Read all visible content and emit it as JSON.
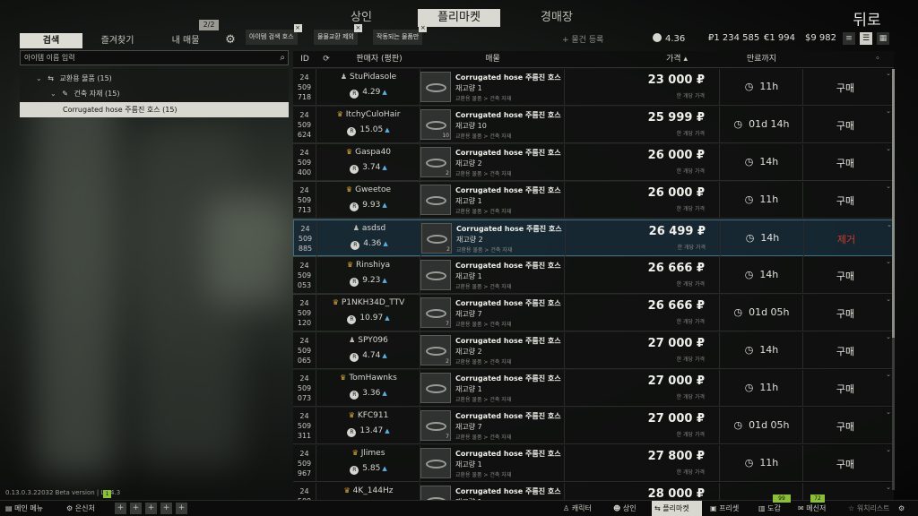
{
  "top_tabs": {
    "traders": "상인",
    "flea_market": "플리마켓",
    "auction": "경매장"
  },
  "back_label": "뒤로",
  "left_tabs": {
    "search": "검색",
    "favorites": "즐겨찾기",
    "my_offers": "내 매물",
    "my_offers_count": "2/2"
  },
  "filter_chips": [
    "아이템 검색 호스",
    "물물교환 제외",
    "작동되는 물품만"
  ],
  "search": {
    "placeholder": "아이템 이름 입력"
  },
  "tree": {
    "level1": "교환용 물품 (15)",
    "level2": "건축 자재 (15)",
    "level3": "Corrugated hose 주름진 호스 (15)"
  },
  "add_offer_label": "+ 물건 등록",
  "currencies": {
    "rep": "4.36",
    "roubles": "₽1 234 585",
    "euros": "€1 994",
    "dollars": "$9 982"
  },
  "table_headers": {
    "id": "ID",
    "seller": "판매자 (평판)",
    "item": "매물",
    "price": "가격",
    "expires": "만료까지"
  },
  "item_name": "Corrugated hose 주름진 호스",
  "item_category": "교환용 물품 > 건축 자재",
  "unit_price_label": "한 개당 가격",
  "rows": [
    {
      "id": [
        "24",
        "509",
        "718"
      ],
      "seller": "StuPidasole",
      "seller_type": "player",
      "rep": "4.29",
      "stock": "재고량 1",
      "count": "",
      "price": "23 000 ₽",
      "expires": "11h",
      "action": "구매",
      "mine": false
    },
    {
      "id": [
        "24",
        "509",
        "624"
      ],
      "seller": "ItchyCuloHair",
      "seller_type": "crown",
      "rep": "15.05",
      "stock": "재고량 10",
      "count": "10",
      "price": "25 999 ₽",
      "expires": "01d 14h",
      "action": "구매",
      "mine": false
    },
    {
      "id": [
        "24",
        "509",
        "400"
      ],
      "seller": "Gaspa40",
      "seller_type": "crown",
      "rep": "3.74",
      "stock": "재고량 2",
      "count": "2",
      "price": "26 000 ₽",
      "expires": "14h",
      "action": "구매",
      "mine": false
    },
    {
      "id": [
        "24",
        "509",
        "713"
      ],
      "seller": "Gweetoe",
      "seller_type": "crown",
      "rep": "9.93",
      "stock": "재고량 1",
      "count": "",
      "price": "26 000 ₽",
      "expires": "11h",
      "action": "구매",
      "mine": false
    },
    {
      "id": [
        "24",
        "509",
        "885"
      ],
      "seller": "asdsd",
      "seller_type": "player",
      "rep": "4.36",
      "stock": "재고량 2",
      "count": "2",
      "price": "26 499 ₽",
      "expires": "14h",
      "action": "제거",
      "mine": true
    },
    {
      "id": [
        "24",
        "509",
        "053"
      ],
      "seller": "Rinshiya",
      "seller_type": "crown",
      "rep": "9.23",
      "stock": "재고량 1",
      "count": "",
      "price": "26 666 ₽",
      "expires": "14h",
      "action": "구매",
      "mine": false
    },
    {
      "id": [
        "24",
        "509",
        "120"
      ],
      "seller": "P1NKH34D_TTV",
      "seller_type": "crown",
      "rep": "10.97",
      "stock": "재고량 7",
      "count": "7",
      "price": "26 666 ₽",
      "expires": "01d 05h",
      "action": "구매",
      "mine": false
    },
    {
      "id": [
        "24",
        "509",
        "065"
      ],
      "seller": "SPY096",
      "seller_type": "player",
      "rep": "4.74",
      "stock": "재고량 2",
      "count": "2",
      "price": "27 000 ₽",
      "expires": "14h",
      "action": "구매",
      "mine": false
    },
    {
      "id": [
        "24",
        "509",
        "073"
      ],
      "seller": "TomHawnks",
      "seller_type": "crown",
      "rep": "3.36",
      "stock": "재고량 1",
      "count": "",
      "price": "27 000 ₽",
      "expires": "11h",
      "action": "구매",
      "mine": false
    },
    {
      "id": [
        "24",
        "509",
        "311"
      ],
      "seller": "KFC911",
      "seller_type": "crown",
      "rep": "13.47",
      "stock": "재고량 7",
      "count": "7",
      "price": "27 000 ₽",
      "expires": "01d 05h",
      "action": "구매",
      "mine": false
    },
    {
      "id": [
        "24",
        "509",
        "967"
      ],
      "seller": "Jlimes",
      "seller_type": "crown",
      "rep": "5.85",
      "stock": "재고량 1",
      "count": "",
      "price": "27 800 ₽",
      "expires": "11h",
      "action": "구매",
      "mine": false
    },
    {
      "id": [
        "24",
        "509",
        ""
      ],
      "seller": "4K_144Hz",
      "seller_type": "crown",
      "rep": "",
      "stock": "재고량 1",
      "count": "",
      "price": "28 000 ₽",
      "expires": "",
      "action": "",
      "mine": false
    }
  ],
  "version": "0.13.0.3.22032 Beta version | L5.4.3",
  "bottom_bar": {
    "main_menu": "메인 메뉴",
    "hideout": "은신처",
    "character": "캐릭터",
    "traders": "상인",
    "flea_market": "플리마켓",
    "presets": "프리셋",
    "handbook": "도감",
    "messenger": "메신저",
    "watchlist": "워치리스트",
    "badge_99": "99",
    "badge_72": "72"
  }
}
